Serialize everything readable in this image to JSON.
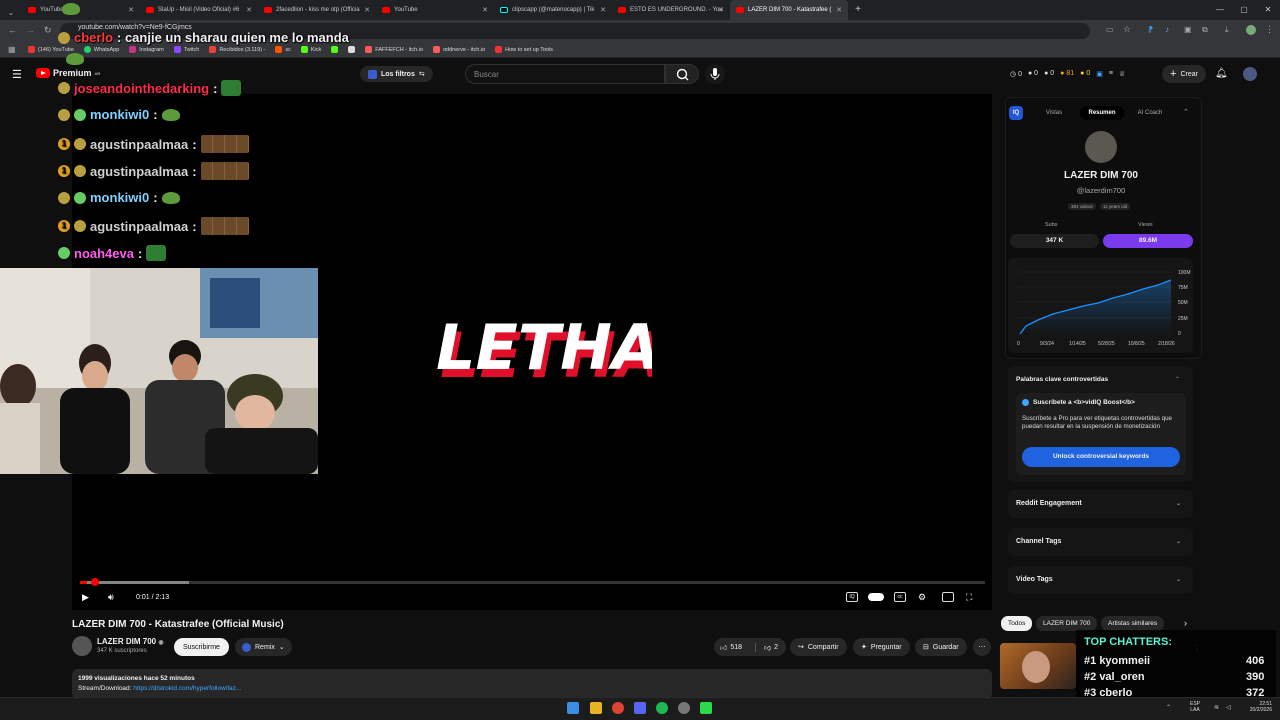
{
  "browser": {
    "tabs": [
      {
        "title": "YouTube",
        "icon": "youtube-favicon"
      },
      {
        "title": "SlaUp - Misil (Video Oficial) #6",
        "icon": "youtube-favicon"
      },
      {
        "title": "2facedlion - kiss me otp (Officia",
        "icon": "youtube-favicon"
      },
      {
        "title": "YouTube",
        "icon": "youtube-favicon"
      },
      {
        "title": "clipscapp (@matenocapp) | Tik",
        "icon": "tiktok-favicon"
      },
      {
        "title": "ESTO ES UNDERGROUND. - You",
        "icon": "youtube-favicon"
      },
      {
        "title": "LAZER DIM 700 - Katastrafee (",
        "icon": "youtube-favicon"
      }
    ],
    "url": "youtube.com/watch?v=Ne9-fCGjmcs",
    "bookmarks": [
      "(146) YouTube",
      "WhatsApp",
      "Instagram",
      "Twitch",
      "Recibidos (3.119) -",
      "sc",
      "Kick",
      "FAFFEFCH - itch.io",
      "oddnerve - itch.io",
      "How to set up Tools"
    ]
  },
  "youtube": {
    "logo_label": "Premium",
    "logo_region": "AR",
    "filters_label": "Los filtros",
    "search_placeholder": "Buscar",
    "stats": [
      "0",
      "0",
      "0",
      "81",
      "0"
    ],
    "create_label": "Crear"
  },
  "chat": [
    {
      "user": "cberlo",
      "color": "#ff3b3b",
      "text": ": canjie un sharau quien me lo manda",
      "emote": ""
    },
    {
      "user": "joseandointhedarking",
      "color": "#ff2b4a",
      "text": ":",
      "emote": "gem"
    },
    {
      "user": "monkiwi0",
      "color": "#7fd0ff",
      "text": ":",
      "emote": "frog"
    },
    {
      "user": "agustinpaalmaa",
      "color": "#cfcfcf",
      "text": ":",
      "emote": "bear"
    },
    {
      "user": "agustinpaalmaa",
      "color": "#cfcfcf",
      "text": ":",
      "emote": "bear"
    },
    {
      "user": "monkiwi0",
      "color": "#7fd0ff",
      "text": ":",
      "emote": "frog"
    },
    {
      "user": "agustinpaalmaa",
      "color": "#cfcfcf",
      "text": ":",
      "emote": "bear"
    },
    {
      "user": "noah4eva",
      "color": "#ff5cf0",
      "text": ":",
      "emote": "gem"
    }
  ],
  "player": {
    "video_text": "LETHAL",
    "time": "0:01 / 2:13",
    "progress_fraction": 0.0075,
    "buffered_fraction": 0.12
  },
  "video": {
    "title": "LAZER DIM 700 - Katastrafee (Official Music)",
    "channel": "LAZER DIM 700",
    "subscribers": "347 K suscriptores",
    "subscribe_label": "Suscribirme",
    "remix_label": "Remix",
    "likes": "518",
    "dislikes": "2",
    "share_label": "Compartir",
    "ask_label": "Preguntar",
    "save_label": "Guardar",
    "views_line": "1999 visualizaciones  hace 52 minutos",
    "desc_prefix": "Stream/Download: ",
    "desc_link": "https://distrokid.com/hyperfollow/laz..."
  },
  "vidiq": {
    "tabs": [
      "Vistas",
      "Resumen",
      "AI Coach"
    ],
    "channel_name": "LAZER DIM 700",
    "handle": "@lazerdim700",
    "videos": "391 videos",
    "age": "11 years old",
    "subs_label": "Subs",
    "views_label": "Views",
    "subs_value": "347 K",
    "views_value": "89.6M",
    "chart": {
      "y_ticks": [
        "100M",
        "75M",
        "50M",
        "25M",
        "0"
      ],
      "x_ticks": [
        "0",
        "9/3/24",
        "1/14/25",
        "5/28/25",
        "10/8/25",
        "2/18/26"
      ]
    },
    "keywords_title": "Palabras clave controvertidas",
    "boost_title": "Suscríbete a <b>vidIQ Boost</b>",
    "boost_text": "Suscríbete a Pro para ver etiquetas controvertidas que puedan resultar en la suspensión de monetización",
    "unlock_label": "Unlock controversial keywords",
    "reddit_label": "Reddit Engagement",
    "channel_tags_label": "Channel Tags",
    "video_tags_label": "Video Tags"
  },
  "chips": [
    "Todos",
    "LAZER DIM 700",
    "Artistas similares"
  ],
  "top_chatters": {
    "title": "TOP CHATTERS:",
    "rows": [
      {
        "rank": "#1",
        "name": "kyommeii",
        "count": "406"
      },
      {
        "rank": "#2",
        "name": "val_oren",
        "count": "390"
      },
      {
        "rank": "#3",
        "name": "cberlo",
        "count": "372"
      }
    ]
  },
  "taskbar": {
    "lang": "ESP",
    "lang2": "LAA",
    "time": "22:51",
    "date": "20/2/2026"
  }
}
